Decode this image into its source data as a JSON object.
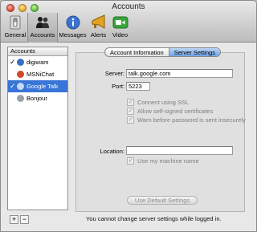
{
  "window": {
    "title": "Accounts"
  },
  "toolbar": {
    "items": [
      {
        "label": "General",
        "icon": "light-switch-icon"
      },
      {
        "label": "Accounts",
        "icon": "people-icon",
        "selected": true
      },
      {
        "label": "Messages",
        "icon": "info-bubble-icon"
      },
      {
        "label": "Alerts",
        "icon": "megaphone-icon"
      },
      {
        "label": "Video",
        "icon": "video-camera-icon"
      }
    ]
  },
  "accounts": {
    "header": "Accounts",
    "items": [
      {
        "name": "digiwam",
        "checked": true,
        "service_color": "#3a6fc5"
      },
      {
        "name": "MSNiChat",
        "checked": false,
        "service_color": "#d04a2a"
      },
      {
        "name": "Google Talk",
        "checked": true,
        "selected": true,
        "service_color": "#c9d8f2"
      },
      {
        "name": "Bonjour",
        "checked": false,
        "service_color": "#9aa1ab"
      }
    ],
    "add_label": "+",
    "remove_label": "−"
  },
  "tabs": [
    {
      "label": "Account Information",
      "active": false
    },
    {
      "label": "Server Settings",
      "active": true
    }
  ],
  "server_settings": {
    "server_label": "Server:",
    "server_value": "talk.google.com",
    "port_label": "Port:",
    "port_value": "5223",
    "checkboxes": [
      {
        "label": "Connect using SSL",
        "checked": true
      },
      {
        "label": "Allow self-signed certificates",
        "checked": true
      },
      {
        "label": "Warn before password is sent insecurely",
        "checked": true
      }
    ],
    "location_label": "Location:",
    "location_value": "",
    "use_machine_name_label": "Use my machine name",
    "use_machine_name_checked": true,
    "default_button_label": "Use Default Settings"
  },
  "status_text": "You cannot change server settings while logged in.",
  "colors": {
    "selection": "#3875d7",
    "tab_active": "#6ea3e7",
    "disabled_text": "#8c8c8c"
  }
}
